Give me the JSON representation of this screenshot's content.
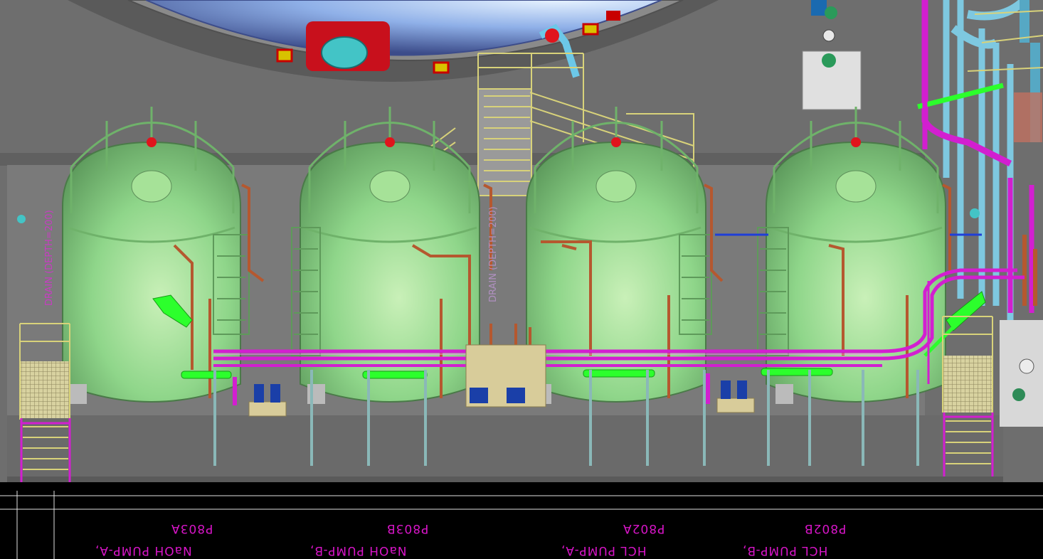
{
  "scene": {
    "title": "",
    "colors": {
      "background": "#6e6e6e",
      "tank_green": "#8fd68a",
      "pipe_magenta": "#d21fd0",
      "pipe_green": "#2cff2c",
      "pipe_copper": "#b5582f",
      "railing_yellow": "#d8d27a",
      "label_magenta": "#d815c8"
    }
  },
  "tank_labels": [
    {
      "tag": "P803A",
      "name": "NaOH PUMP-A,"
    },
    {
      "tag": "P803B",
      "name": "NaOH PUMP-B,"
    },
    {
      "tag": "P802A",
      "name": "HCL PUMP-A,"
    },
    {
      "tag": "P802B",
      "name": "HCL PUMP-B,"
    }
  ],
  "drain_labels": [
    {
      "text": "DRAIN (DEPTH=200)"
    },
    {
      "text": "DRAIN (DEPTH=200)"
    }
  ]
}
